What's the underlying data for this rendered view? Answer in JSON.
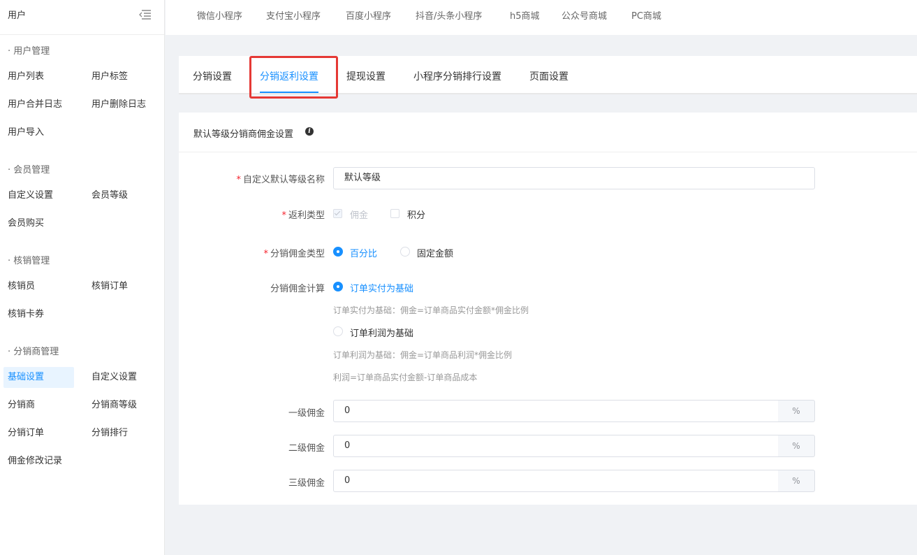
{
  "sidebar": {
    "title": "用户",
    "toggle_icon": "menu-fold-icon",
    "groups": [
      {
        "label": "· 用户管理"
      },
      {
        "label": "· 会员管理"
      },
      {
        "label": "· 核销管理"
      },
      {
        "label": "· 分销商管理"
      }
    ],
    "items": {
      "user_list": "用户列表",
      "user_tags": "用户标签",
      "user_merge_log": "用户合并日志",
      "user_delete_log": "用户删除日志",
      "user_import": "用户导入",
      "custom_settings": "自定义设置",
      "member_levels": "会员等级",
      "member_purchase": "会员购买",
      "verifier": "核销员",
      "verify_orders": "核销订单",
      "verify_cards": "核销卡券",
      "basic_settings": "基础设置",
      "dist_custom_settings": "自定义设置",
      "distributors": "分销商",
      "distributor_levels": "分销商等级",
      "dist_orders": "分销订单",
      "dist_ranking": "分销排行",
      "commission_log": "佣金修改记录"
    }
  },
  "topbar": {
    "tabs": [
      "微信小程序",
      "支付宝小程序",
      "百度小程序",
      "抖音/头条小程序",
      "h5商城",
      "公众号商城",
      "PC商城"
    ]
  },
  "tabs": {
    "items": [
      "分销设置",
      "分销返利设置",
      "提现设置",
      "小程序分销排行设置",
      "页面设置"
    ],
    "active": "分销返利设置"
  },
  "form": {
    "card_title": "默认等级分销商佣金设置",
    "level_name_label": "自定义默认等级名称",
    "level_name_value": "默认等级",
    "rebate_type_label": "返利类型",
    "rebate_options": [
      "佣金",
      "积分"
    ],
    "commission_type_label": "分销佣金类型",
    "commission_type_options": [
      "百分比",
      "固定金额"
    ],
    "calc_label": "分销佣金计算",
    "calc_option_1": "订单实付为基础",
    "calc_hint_1": "订单实付为基础：佣金=订单商品实付金额*佣金比例",
    "calc_option_2": "订单利润为基础",
    "calc_hint_2": "订单利润为基础：佣金=订单商品利润*佣金比例",
    "calc_hint_3": "利润=订单商品实付金额-订单商品成本",
    "level1_label": "一级佣金",
    "level1_value": "0",
    "level2_label": "二级佣金",
    "level2_value": "0",
    "level3_label": "三级佣金",
    "level3_value": "0",
    "unit": "%"
  }
}
